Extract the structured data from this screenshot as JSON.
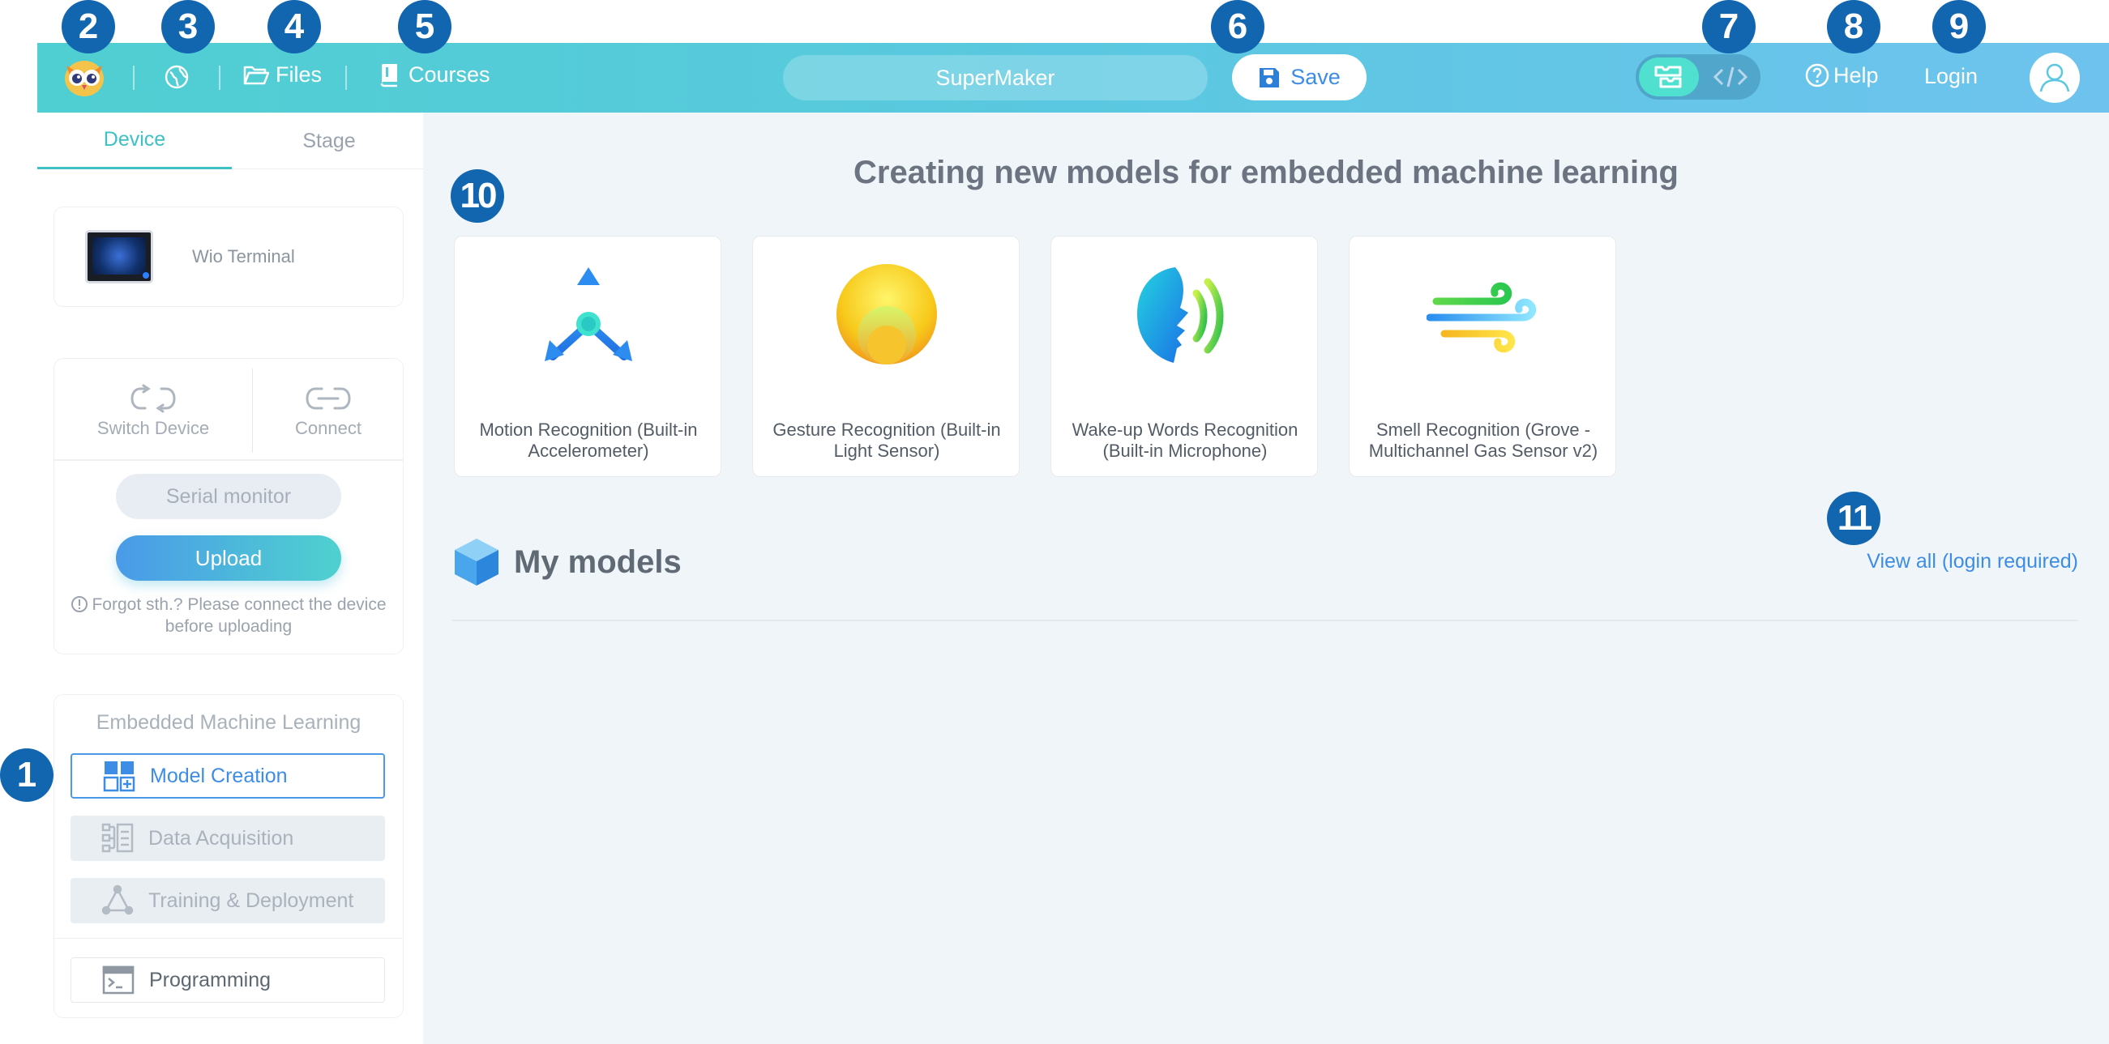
{
  "header": {
    "files_label": "Files",
    "courses_label": "Courses",
    "project_name": "SuperMaker",
    "save_label": "Save",
    "help_label": "Help",
    "login_label": "Login",
    "accent_gradient": [
      "#4fcfd1",
      "#6ec3ee"
    ]
  },
  "left": {
    "tabs": [
      {
        "label": "Device"
      },
      {
        "label": "Stage"
      }
    ],
    "device_name": "Wio Terminal",
    "switch_device_label": "Switch Device",
    "connect_label": "Connect",
    "serial_monitor_label": "Serial monitor",
    "upload_label": "Upload",
    "hint": "Forgot sth.? Please connect the device before uploading",
    "eml_title": "Embedded Machine Learning",
    "menu": [
      {
        "label": "Model Creation",
        "state": "active"
      },
      {
        "label": "Data Acquisition",
        "state": "disabled"
      },
      {
        "label": "Training & Deployment",
        "state": "disabled"
      },
      {
        "label": "Programming",
        "state": "enabled"
      }
    ]
  },
  "main": {
    "title": "Creating new models for embedded machine learning",
    "models": [
      {
        "label": "Motion Recognition (Built-in Accelerometer)",
        "icon": "motion-icon"
      },
      {
        "label": "Gesture Recognition (Built-in Light Sensor)",
        "icon": "gesture-icon"
      },
      {
        "label": "Wake-up Words Recognition (Built-in Microphone)",
        "icon": "voice-icon"
      },
      {
        "label": "Smell Recognition (Grove - Multichannel Gas Sensor v2)",
        "icon": "smell-icon"
      }
    ],
    "my_models_label": "My models",
    "view_all_label": "View all (login required)"
  },
  "badges": [
    "1",
    "2",
    "3",
    "4",
    "5",
    "6",
    "7",
    "8",
    "9",
    "10",
    "11"
  ]
}
